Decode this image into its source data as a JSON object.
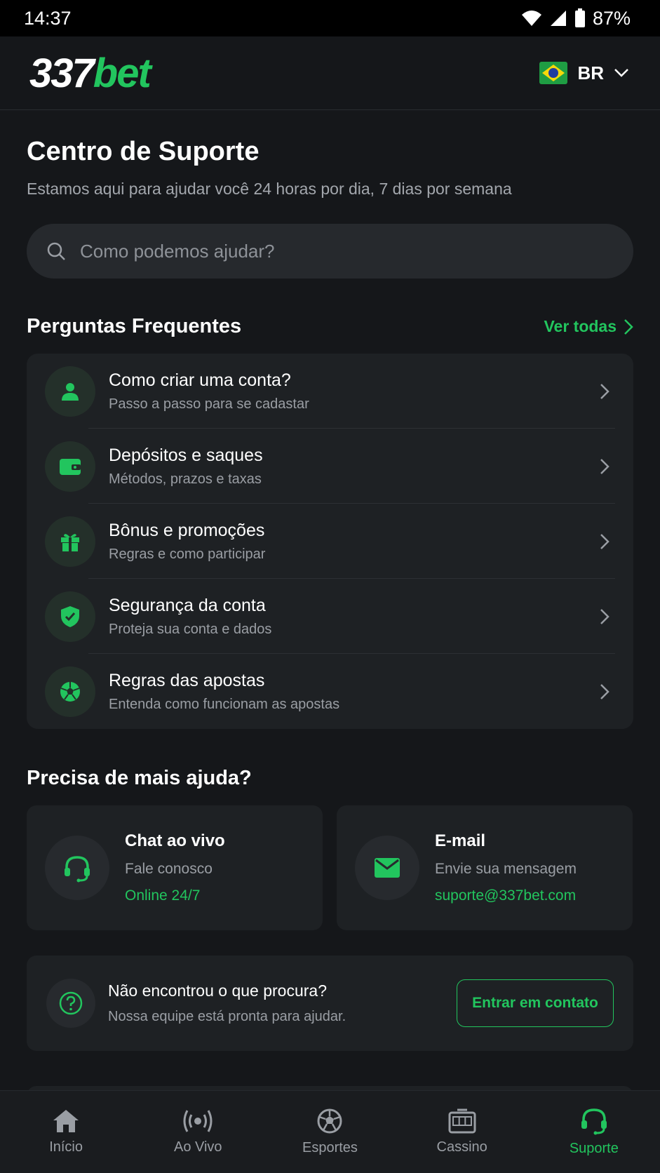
{
  "status_bar": {
    "time": "14:37",
    "battery": "87%"
  },
  "header": {
    "logo_num": "337",
    "logo_bet": "bet",
    "lang_code": "BR"
  },
  "page": {
    "title": "Centro de Suporte",
    "subtitle": "Estamos aqui para ajudar você 24 horas por dia, 7 dias por semana"
  },
  "search": {
    "placeholder": "Como podemos ajudar?"
  },
  "faq": {
    "title": "Perguntas Frequentes",
    "see_all": "Ver todas",
    "items": [
      {
        "title": "Como criar uma conta?",
        "desc": "Passo a passo para se cadastar",
        "icon": "user-icon"
      },
      {
        "title": "Depósitos e saques",
        "desc": "Métodos, prazos e taxas",
        "icon": "wallet-icon"
      },
      {
        "title": "Bônus e promoções",
        "desc": "Regras e como participar",
        "icon": "gift-icon"
      },
      {
        "title": "Segurança da conta",
        "desc": "Proteja sua conta e dados",
        "icon": "shield-icon"
      },
      {
        "title": "Regras das apostas",
        "desc": "Entenda como funcionam as apostas",
        "icon": "soccer-ball-icon"
      }
    ]
  },
  "help": {
    "title": "Precisa de mais ajuda?",
    "chat": {
      "name": "Chat ao vivo",
      "desc": "Fale conosco",
      "extra": "Online 24/7"
    },
    "email": {
      "name": "E-mail",
      "desc": "Envie sua mensagem",
      "extra": "suporte@337bet.com"
    }
  },
  "contact": {
    "title": "Não encontrou o que procura?",
    "desc": "Nossa equipe está pronta para ajudar.",
    "button": "Entrar em contato"
  },
  "nav": {
    "items": [
      {
        "label": "Início",
        "icon": "home-icon"
      },
      {
        "label": "Ao Vivo",
        "icon": "live-icon"
      },
      {
        "label": "Esportes",
        "icon": "soccer-ball-icon"
      },
      {
        "label": "Cassino",
        "icon": "slot-machine-icon"
      },
      {
        "label": "Suporte",
        "icon": "headset-icon"
      }
    ],
    "active": "Suporte"
  },
  "colors": {
    "accent": "#22c55e",
    "background": "#15171a",
    "card": "#1e2124"
  }
}
